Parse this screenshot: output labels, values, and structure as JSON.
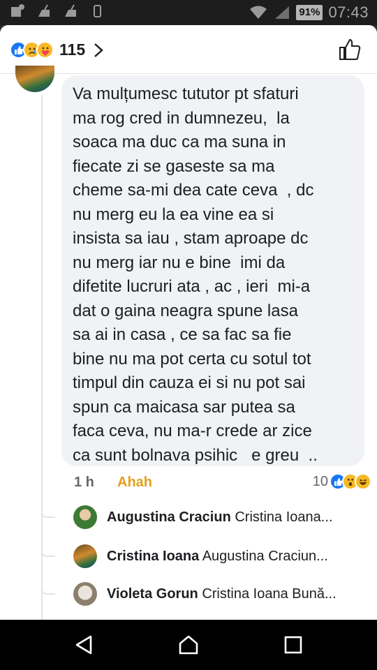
{
  "status_bar": {
    "left_icons": [
      "app-notification-icon",
      "cleaner-icon",
      "cleaner-icon",
      "phone-icon"
    ],
    "battery": "91%",
    "time": "07:43"
  },
  "header": {
    "reaction_icons": [
      "like-icon",
      "sad-icon",
      "care-icon"
    ],
    "reaction_count": "115"
  },
  "comment": {
    "text": "Va mulțumesc tututor pt sfaturi\nma rog cred in dumnezeu,  la\nsoaca ma duc ca ma suna in\nfiecate zi se gaseste sa ma\ncheme sa-mi dea cate ceva  , dc\nnu merg eu la ea vine ea si\ninsista sa iau , stam aproape dc\nnu merg iar nu e bine  imi da\ndifetite lucruri ata , ac , ieri  mi-a\ndat o gaina neagra spune lasa\nsa ai in casa , ce sa fac sa fie\nbine nu ma pot certa cu sotul tot\ntimpul din cauza ei si nu pot sai\nspun ca maicasa sar putea sa\nfaca ceva, nu ma-r crede ar zice\nca sunt bolnava psihic   e greu  ..",
    "time": "1 h",
    "reaction_label": "Ahah",
    "reaction_count": "10",
    "reaction_icons": [
      "like-icon",
      "wow-icon",
      "haha-icon"
    ]
  },
  "replies": [
    {
      "name": "Augustina Craciun",
      "preview": "Cristina Ioana..."
    },
    {
      "name": "Cristina Ioana",
      "preview": "Augustina Craciun..."
    },
    {
      "name": "Violeta Gorun",
      "preview": "Cristina Ioana Bună..."
    }
  ],
  "navigation": [
    "back-icon",
    "home-icon",
    "recents-icon"
  ],
  "colors": {
    "accent": "#1877f2",
    "haha": "#e4a01c",
    "bubble": "#f0f2f5"
  }
}
